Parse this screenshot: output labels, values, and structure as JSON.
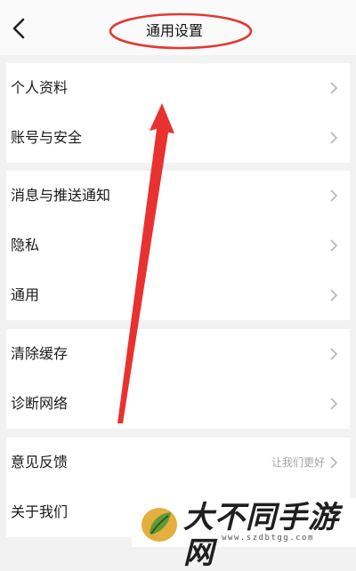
{
  "header": {
    "title": "通用设置",
    "back_icon": "chevron-left-icon"
  },
  "groups": [
    {
      "items": [
        {
          "label": "个人资料"
        },
        {
          "label": "账号与安全"
        }
      ]
    },
    {
      "items": [
        {
          "label": "消息与推送通知"
        },
        {
          "label": "隐私"
        },
        {
          "label": "通用"
        }
      ]
    },
    {
      "items": [
        {
          "label": "清除缓存"
        },
        {
          "label": "诊断网络"
        }
      ]
    },
    {
      "items": [
        {
          "label": "意见反馈",
          "hint": "让我们更好"
        },
        {
          "label": "关于我们"
        }
      ]
    }
  ],
  "annotation": {
    "arrow_color": "#e8322f",
    "ellipse_color": "#e23a33"
  },
  "watermark": {
    "text": "大不同手游网",
    "url": "www.szdbtgg.com"
  }
}
